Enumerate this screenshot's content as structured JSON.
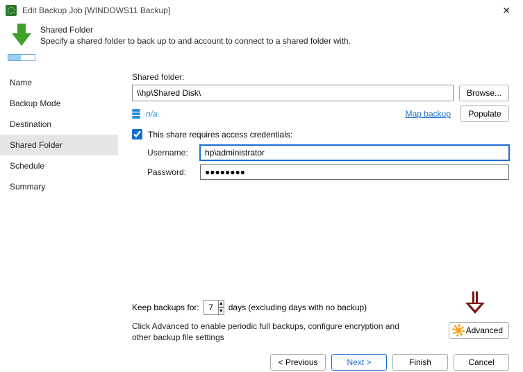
{
  "window": {
    "title": "Edit Backup Job [WINDOWS11 Backup]"
  },
  "header": {
    "title": "Shared Folder",
    "subtitle": "Specify a shared folder to back up to and account to connect to a shared folder with."
  },
  "sidebar": {
    "items": [
      {
        "label": "Name"
      },
      {
        "label": "Backup Mode"
      },
      {
        "label": "Destination"
      },
      {
        "label": "Shared Folder"
      },
      {
        "label": "Schedule"
      },
      {
        "label": "Summary"
      }
    ],
    "selected_index": 3
  },
  "shared_folder": {
    "label": "Shared folder:",
    "value": "\\\\hp\\Shared Disk\\",
    "browse": "Browse...",
    "na": "n/a",
    "map_backup": "Map backup",
    "populate": "Populate"
  },
  "credentials": {
    "checkbox_label": "This share requires access credentials:",
    "checked": true,
    "username_label": "Username:",
    "username_value": "hp\\administrator",
    "password_label": "Password:",
    "password_value": "●●●●●●●●"
  },
  "retention": {
    "prefix": "Keep backups for:",
    "days_value": "7",
    "suffix": "days (excluding days with no backup)"
  },
  "hint": "Click Advanced to enable periodic full backups, configure encryption and other backup file settings",
  "advanced_label": "Advanced",
  "footer": {
    "previous": "< Previous",
    "next": "Next >",
    "finish": "Finish",
    "cancel": "Cancel"
  }
}
